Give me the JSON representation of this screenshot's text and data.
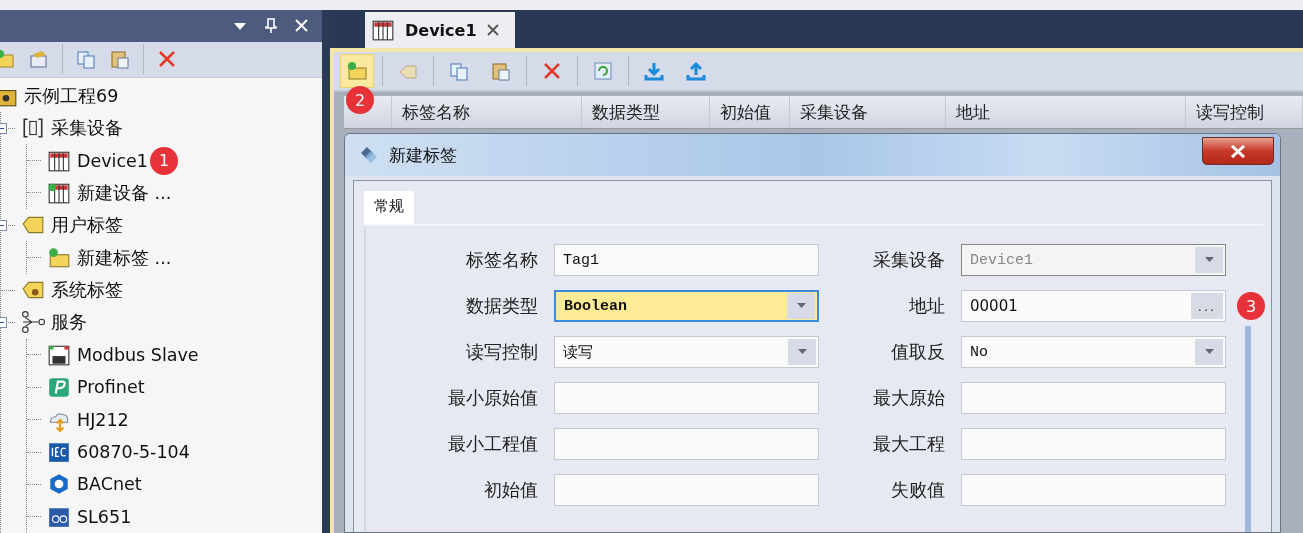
{
  "left_panel": {
    "title_buttons": [
      {
        "kind": "dropdown"
      },
      {
        "kind": "pin"
      },
      {
        "kind": "close"
      }
    ],
    "toolbar": [
      {
        "kind": "new-folder"
      },
      {
        "kind": "properties"
      },
      {
        "kind": "copy"
      },
      {
        "kind": "paste"
      },
      {
        "kind": "delete"
      }
    ],
    "tree": [
      {
        "label": "示例工程69",
        "kind": "project",
        "children": [
          {
            "label": "采集设备",
            "kind": "device-group",
            "expanded": true,
            "children": [
              {
                "label": "Device1",
                "kind": "device",
                "badge": "1"
              },
              {
                "label": "新建设备 ...",
                "kind": "new-device"
              }
            ]
          },
          {
            "label": "用户标签",
            "kind": "tag-group",
            "expanded": true,
            "children": [
              {
                "label": "新建标签 ...",
                "kind": "new-tag"
              }
            ]
          },
          {
            "label": "系统标签",
            "kind": "system-tags"
          },
          {
            "label": "服务",
            "kind": "services",
            "expanded": true,
            "children": [
              {
                "label": "Modbus Slave",
                "kind": "network-port"
              },
              {
                "label": "Profinet",
                "kind": "profinet"
              },
              {
                "label": "HJ212",
                "kind": "cloud"
              },
              {
                "label": "60870-5-104",
                "kind": "iec"
              },
              {
                "label": "BACnet",
                "kind": "hexagon"
              },
              {
                "label": "SL651",
                "kind": "water"
              }
            ]
          }
        ]
      }
    ]
  },
  "tabs": [
    {
      "label": "Device1",
      "selected": true
    }
  ],
  "toolbar": [
    {
      "kind": "new-tag",
      "highlighted": true,
      "badge": "2"
    },
    {
      "kind": "edit-tag",
      "highlighted": false
    },
    {
      "kind": "copy",
      "highlighted": false
    },
    {
      "kind": "paste",
      "highlighted": false
    },
    {
      "kind": "delete",
      "highlighted": false
    },
    {
      "kind": "refresh",
      "highlighted": false
    },
    {
      "kind": "download",
      "highlighted": false
    },
    {
      "kind": "upload",
      "highlighted": false
    }
  ],
  "table": {
    "columns": [
      "标签名称",
      "数据类型",
      "初始值",
      "采集设备",
      "地址",
      "读写控制"
    ]
  },
  "dialog": {
    "title": "新建标签",
    "tabs": [
      {
        "label": "常规",
        "selected": true
      }
    ],
    "fields": [
      {
        "label": "标签名称",
        "value": "Tag1",
        "kind": "text",
        "disabled": false,
        "focused": false
      },
      {
        "label": "采集设备",
        "value": "Device1",
        "kind": "combo",
        "disabled": true,
        "focused": false
      },
      {
        "label": "数据类型",
        "value": "Boolean",
        "kind": "combo",
        "disabled": false,
        "focused": true
      },
      {
        "label": "地址",
        "value": "00001",
        "kind": "browse",
        "disabled": false,
        "focused": false,
        "badge": "3",
        "button": "..."
      },
      {
        "label": "读写控制",
        "value": "读写",
        "kind": "combo",
        "disabled": false,
        "focused": false
      },
      {
        "label": "值取反",
        "value": "No",
        "kind": "combo",
        "disabled": false,
        "focused": false
      },
      {
        "label": "最小原始值",
        "kind": "text",
        "disabled": false,
        "focused": false
      },
      {
        "label": "最大原始",
        "kind": "text",
        "disabled": false,
        "focused": false
      },
      {
        "label": "最小工程值",
        "kind": "text",
        "disabled": false,
        "focused": false
      },
      {
        "label": "最大工程",
        "kind": "text",
        "disabled": false,
        "focused": false
      },
      {
        "label": "初始值",
        "kind": "text",
        "disabled": false,
        "focused": false
      },
      {
        "label": "失败值",
        "kind": "text",
        "disabled": false,
        "focused": false
      }
    ]
  }
}
